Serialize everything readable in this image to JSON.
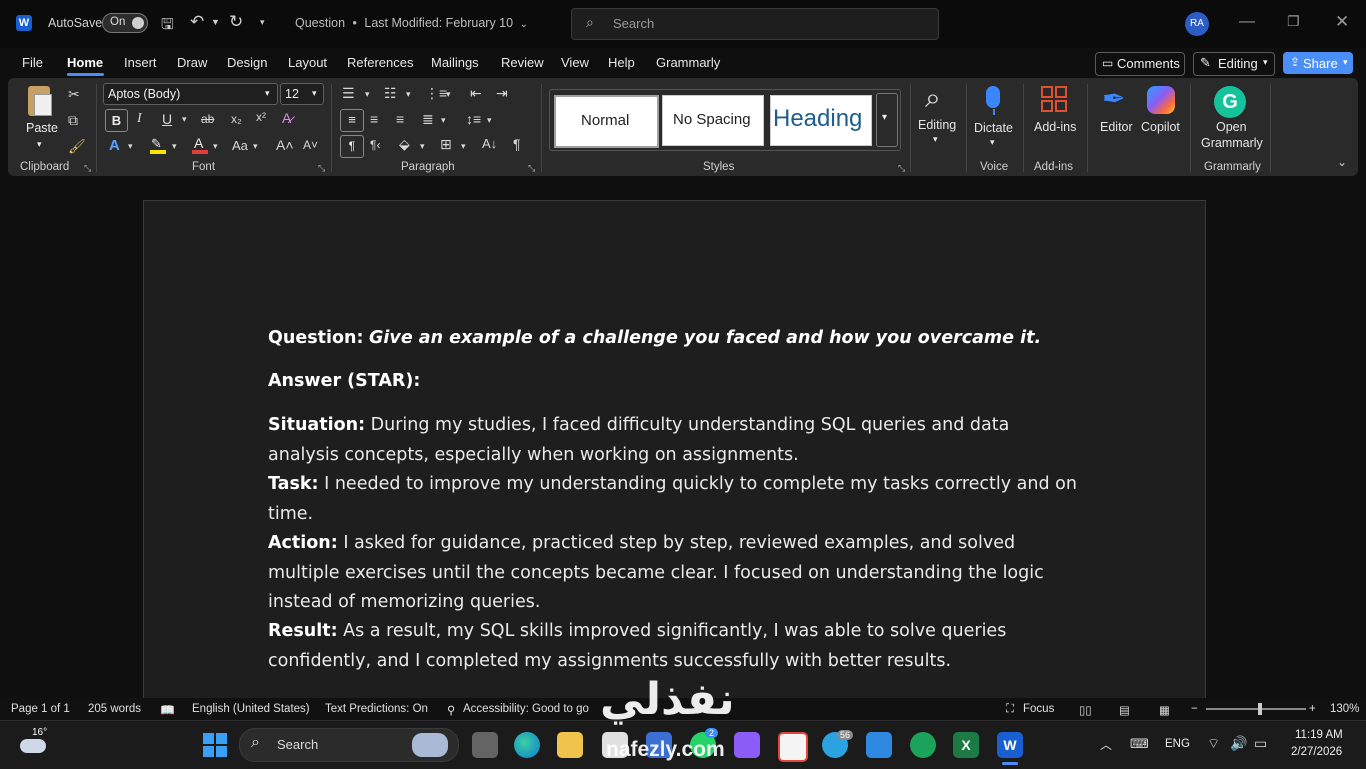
{
  "titlebar": {
    "autosave_label": "AutoSave",
    "autosave_state": "On",
    "doc_title": "Question",
    "separator": "•",
    "modified": "Last Modified: February 10",
    "search_placeholder": "Search",
    "avatar": "RA"
  },
  "menu": {
    "tabs": [
      "File",
      "Home",
      "Insert",
      "Draw",
      "Design",
      "Layout",
      "References",
      "Mailings",
      "Review",
      "View",
      "Help",
      "Grammarly"
    ],
    "active": "Home",
    "comments": "Comments",
    "editing": "Editing",
    "share": "Share"
  },
  "ribbon": {
    "clipboard": {
      "paste": "Paste",
      "group": "Clipboard"
    },
    "font": {
      "name": "Aptos (Body)",
      "size": "12",
      "group": "Font"
    },
    "paragraph": {
      "group": "Paragraph"
    },
    "styles": {
      "normal": "Normal",
      "nospacing": "No Spacing",
      "heading": "Heading",
      "group": "Styles"
    },
    "editing": {
      "label": "Editing"
    },
    "voice": {
      "dictate": "Dictate",
      "group": "Voice"
    },
    "addins": {
      "label": "Add-ins",
      "group": "Add-ins"
    },
    "editor": "Editor",
    "copilot": "Copilot",
    "grammarly": {
      "open": "Open",
      "grammarly": "Grammarly",
      "group": "Grammarly"
    }
  },
  "document": {
    "question_label": "Question:",
    "question_text": "Give an example of a challenge you faced and how you overcame it.",
    "answer_label": "Answer (STAR):",
    "situation_label": "Situation:",
    "situation_text_1": " During my studies, I faced difficulty understanding SQL queries and data",
    "situation_text_2": "analysis concepts, especially when working on assignments.",
    "task_label": "Task:",
    "task_text_1": " I needed to improve my understanding quickly to complete my tasks correctly and on",
    "task_text_2": "time.",
    "action_label": "Action:",
    "action_text_1": " I asked for guidance, practiced step by step, reviewed examples, and solved",
    "action_text_2": "multiple exercises until the concepts became clear. I focused on understanding the logic",
    "action_text_3": "instead of memorizing queries.",
    "result_label": "Result:",
    "result_text_1": " As a result, my SQL skills improved significantly, I was able to solve queries",
    "result_text_2": "confidently, and I completed my assignments successfully with better results."
  },
  "statusbar": {
    "page": "Page 1 of 1",
    "words": "205 words",
    "language": "English (United States)",
    "predictions": "Text Predictions: On",
    "accessibility": "Accessibility: Good to go",
    "focus": "Focus",
    "zoom": "130%"
  },
  "taskbar": {
    "weather": "16°",
    "search": "Search",
    "lang": "ENG",
    "time": "11:19 AM",
    "date": "2/27/2026",
    "badge_whatsapp": "2",
    "badge_telegram": "56"
  },
  "watermark": {
    "arabic": "نفذلي",
    "latin": "nafezly.com"
  }
}
